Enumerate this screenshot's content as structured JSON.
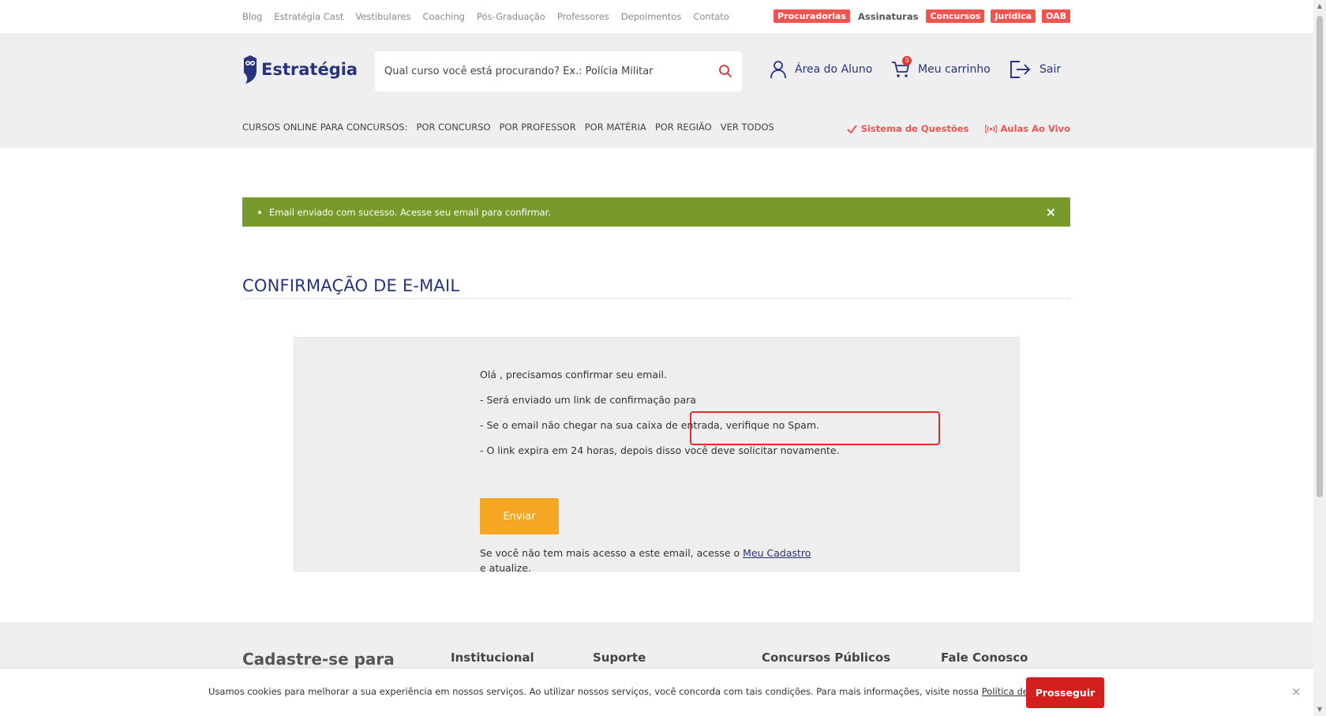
{
  "topbar": {
    "links": [
      "Blog",
      "Estratégia Cast",
      "Vestibulares",
      "Coaching",
      "Pós-Graduação",
      "Professores",
      "Depoimentos",
      "Contato"
    ],
    "badges": [
      "Procuradorias",
      "Assinaturas",
      "Concursos",
      "Jurídica",
      "OAB"
    ]
  },
  "header": {
    "logo_text": "Estratégia",
    "search_placeholder": "Qual curso você está procurando? Ex.: Polícia Militar",
    "student_area": "Área do Aluno",
    "cart_label": "Meu carrinho",
    "cart_count": "0",
    "logout": "Sair",
    "catnav": {
      "label": "CURSOS ONLINE PARA CONCURSOS:",
      "items": [
        "POR CONCURSO",
        "POR PROFESSOR",
        "POR MATÉRIA",
        "POR REGIÃO",
        "VER TODOS"
      ]
    },
    "right_links": {
      "questions": "Sistema de Questões",
      "live": "Aulas Ao Vivo"
    }
  },
  "alert": {
    "message": "Email enviado com sucesso. Acesse seu email para confirmar.",
    "close": "×"
  },
  "page": {
    "title": "CONFIRMAÇÃO DE E-MAIL"
  },
  "confirm": {
    "line1": "Olá , precisamos confirmar seu email.",
    "line2": "- Será enviado um link de confirmação para",
    "line3": "- Se o email não chegar na sua caixa de entrada, verifique no Spam.",
    "line4": "- O link expira em 24 horas, depois disso você deve solicitar novamente.",
    "email_value": "",
    "send_button": "Enviar",
    "note_before": "Se você não tem mais acesso a este email, acesse o ",
    "note_link": "Meu Cadastro",
    "note_after": " e atualize."
  },
  "footer": {
    "signup": "Cadastre-se para",
    "col1": "Institucional",
    "col2": "Suporte",
    "col3": "Concursos Públicos",
    "col4": "Fale Conosco"
  },
  "cookie": {
    "text": "Usamos cookies para melhorar a sua experiência em nossos serviços. Ao utilizar nossos serviços, você concorda com tais condições. Para mais informações, visite nossa ",
    "link": "Política de privacidade",
    "suffix": ".",
    "button": "Prosseguir",
    "close": "×"
  },
  "colors": {
    "brand_blue": "#26337e",
    "badge_red": "#f0544f",
    "alert_green": "#789a2c",
    "send_orange": "#f5a623",
    "cookie_red": "#d41f1f"
  }
}
